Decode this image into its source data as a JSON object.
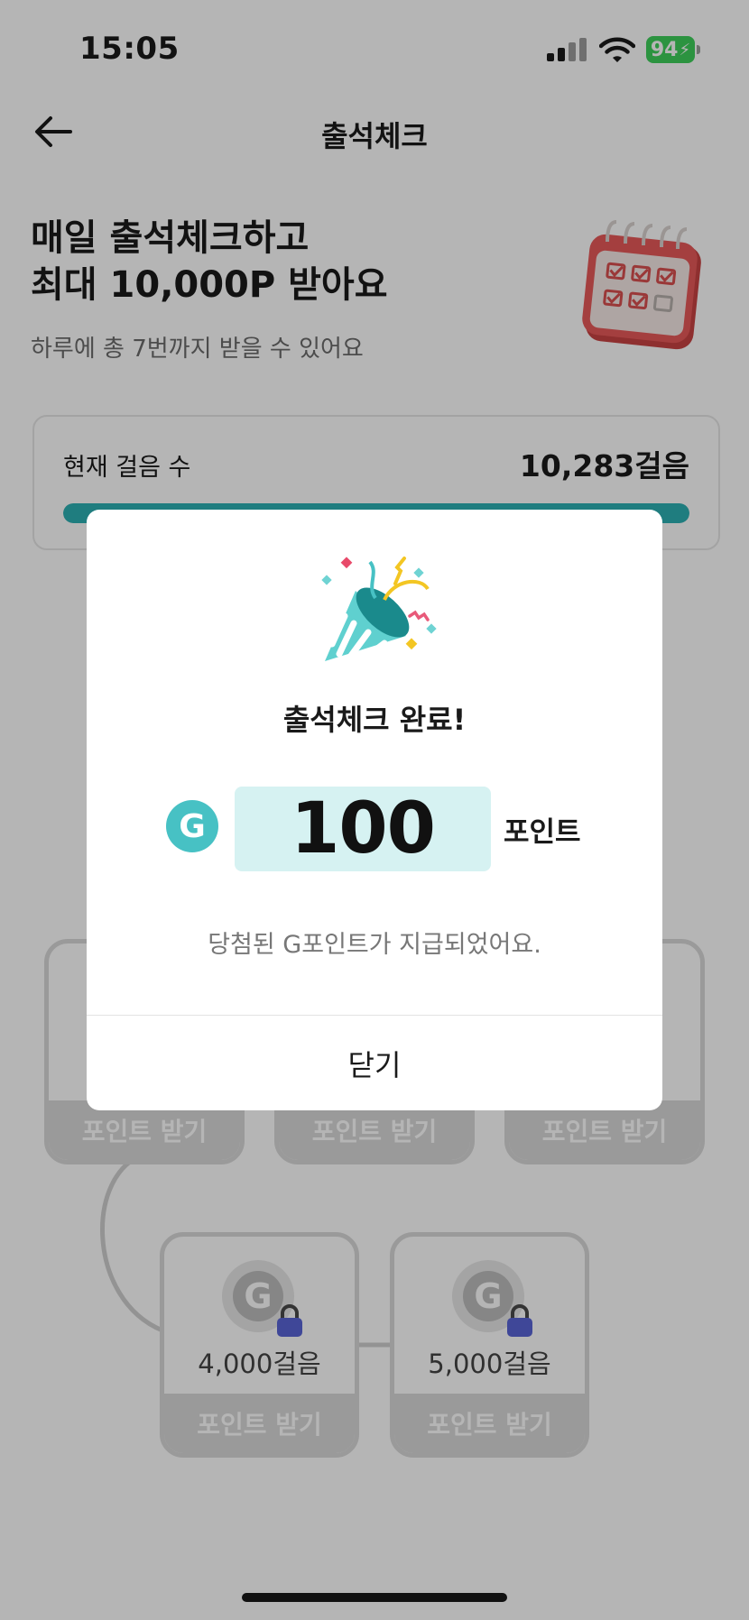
{
  "status_bar": {
    "time": "15:05",
    "battery": "94"
  },
  "header": {
    "title": "출석체크"
  },
  "hero": {
    "title_line1": "매일 출석체크하고",
    "title_line2": "최대 10,000P 받아요",
    "subtitle": "하루에 총 7번까지 받을 수 있어요"
  },
  "steps": {
    "label": "현재 걸음 수",
    "value": "10,283걸음",
    "progress": 1.0
  },
  "tiles": [
    {
      "steps": "4,000걸음",
      "button": "포인트 받기",
      "locked": true
    },
    {
      "steps": "5,000걸음",
      "button": "포인트 받기",
      "locked": true
    },
    {
      "button": "포인트 받기"
    },
    {
      "button": "포인트 받기"
    },
    {
      "button": "포인트 받기"
    }
  ],
  "modal": {
    "title": "출석체크 완료!",
    "badge": "G",
    "points": "100",
    "points_unit": "포인트",
    "description": "당첨된 G포인트가 지급되었어요.",
    "close_label": "닫기"
  },
  "colors": {
    "accent": "#2cb1b4",
    "badge": "#47c1c4",
    "points_bg": "#d6f2f2",
    "lock": "#5a64d6",
    "calendar": "#e85a5a",
    "battery": "#3ecf5b"
  }
}
